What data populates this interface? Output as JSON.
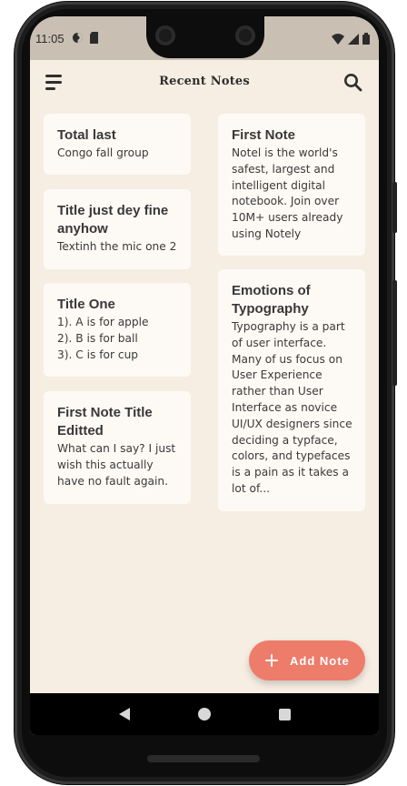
{
  "status_bar": {
    "time": "11:05",
    "left_icons": [
      "settings-circle-icon",
      "sd-card-icon"
    ],
    "right_icons": [
      "wifi-icon",
      "signal-icon",
      "battery-icon"
    ]
  },
  "app_bar": {
    "title": "Recent Notes",
    "menu_icon": "menu-icon",
    "search_icon": "search-icon"
  },
  "notes": {
    "left": [
      {
        "title": "Total last",
        "body": "Congo fall group"
      },
      {
        "title": "Title just dey fine anyhow",
        "body": "Textinh the mic one 2"
      },
      {
        "title": "Title One",
        "body": "1). A is for apple\n2). B is for ball\n3). C is for cup"
      },
      {
        "title": "First Note Title Editted",
        "body": "What can I say? I just wish this actually have no fault again."
      }
    ],
    "right": [
      {
        "title": "First Note",
        "body": "Notel is the world's safest, largest and intelligent digital notebook. Join over 10M+ users already using Notely"
      },
      {
        "title": "Emotions of Typography",
        "body": "Typography is a part of user interface. Many of us focus on User Experience rather than User Interface as novice UI/UX designers since deciding a typface, colors, and typefaces is a pain as it takes a lot of..."
      }
    ]
  },
  "fab": {
    "label": "Add Note",
    "color": "#ee7c6a"
  },
  "nav_bar": {
    "icons": [
      "back-icon",
      "home-icon",
      "recents-icon"
    ]
  },
  "colors": {
    "background": "#f6ede3",
    "card": "#fdfaf5",
    "status_bar": "#c9bfb3"
  }
}
